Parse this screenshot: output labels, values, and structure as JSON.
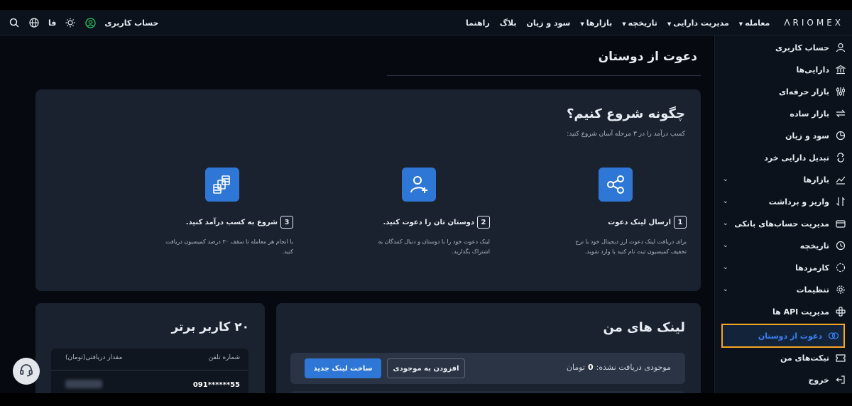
{
  "topbar": {
    "logo": "ΛRIOMEX",
    "nav": [
      {
        "label": "معامله",
        "caret": true
      },
      {
        "label": "مدیریت دارایی",
        "caret": true
      },
      {
        "label": "تاریخچه",
        "caret": true
      },
      {
        "label": "بازارها",
        "caret": true
      },
      {
        "label": "سود و زیان",
        "caret": false
      },
      {
        "label": "بلاگ",
        "caret": false
      },
      {
        "label": "راهنما",
        "caret": false
      }
    ],
    "account_label": "حساب کاربری",
    "language": "فا"
  },
  "sidebar": {
    "items": [
      {
        "label": "حساب کاربری",
        "icon": "user-icon"
      },
      {
        "label": "دارایی‌ها",
        "icon": "bank-icon"
      },
      {
        "label": "بازار حرفه‌ای",
        "icon": "sliders-icon"
      },
      {
        "label": "بازار ساده",
        "icon": "swap-icon"
      },
      {
        "label": "سود و زیان",
        "icon": "pie-chart-icon"
      },
      {
        "label": "تبدیل دارایی خرد",
        "icon": "convert-icon"
      },
      {
        "label": "بازارها",
        "icon": "chart-icon",
        "chevron": true
      },
      {
        "label": "واریز و برداشت",
        "icon": "transfer-icon",
        "chevron": true
      },
      {
        "label": "مدیریت حساب‌های بانکی",
        "icon": "card-icon",
        "chevron": true
      },
      {
        "label": "تاریخچه",
        "icon": "history-icon",
        "chevron": true
      },
      {
        "label": "کارمزدها",
        "icon": "fee-icon",
        "chevron": true
      },
      {
        "label": "تنظیمات",
        "icon": "settings-icon",
        "chevron": true
      },
      {
        "label": "مدیریت API ها",
        "icon": "api-icon"
      },
      {
        "label": "دعوت از دوستان",
        "icon": "invite-icon",
        "active": true
      },
      {
        "label": "تیکت‌های من",
        "icon": "ticket-icon"
      },
      {
        "label": "خروج",
        "icon": "logout-icon"
      }
    ]
  },
  "page": {
    "title": "دعوت از دوستان"
  },
  "how": {
    "title": "چگونه شروع کنیم؟",
    "subtitle": "کسب درآمد را در ۳ مرحله آسان شروع کنید:",
    "steps": [
      {
        "num": "1",
        "title": "ارسال لینک دعوت",
        "desc": "برای دریافت لینک دعوت ارز دیجیتال خود با نرخ تخفیف کمیسیون ثبت نام کنید یا وارد شوید."
      },
      {
        "num": "2",
        "title": "دوستان تان را دعوت کنید.",
        "desc": "لینک دعوت خود را با دوستان و دنبال کنندگان به اشتراک بگذارید."
      },
      {
        "num": "3",
        "title": "شروع به کسب درآمد کنید.",
        "desc": "با انجام هر معامله تا سقف ۳۰ درصد کمیسیون دریافت کنید."
      }
    ]
  },
  "links": {
    "title": "لینک های من",
    "balance_label": "موجودی دریافت نشده:",
    "balance_value": "0",
    "balance_unit": "تومان",
    "add_button": "افزودن به موجودی",
    "new_button": "ساخت لینک جدید"
  },
  "top_users": {
    "title": "۲۰ کاربر برتر",
    "col_phone": "شماره تلفن",
    "col_amount": "مقدار دریافتی(تومان)",
    "rows": [
      {
        "phone": "091******55"
      }
    ]
  }
}
